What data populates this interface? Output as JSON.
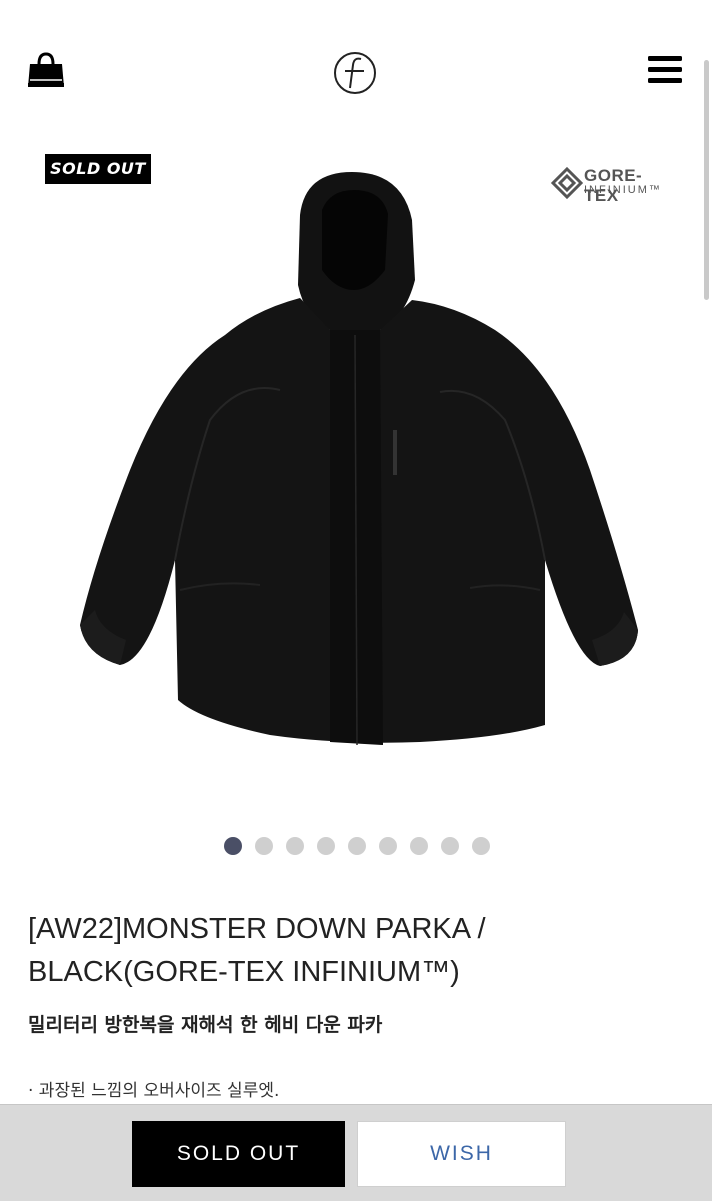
{
  "header": {
    "cart_icon": "shopping-bag-icon",
    "logo_icon": "brand-logo",
    "menu_icon": "hamburger-menu-icon"
  },
  "product": {
    "badge": "SOLD OUT",
    "partner_logo_top": "GORE-TEX",
    "partner_logo_bottom": "INFINIUM™",
    "image_count": 9,
    "active_image": 1,
    "title": "[AW22]MONSTER DOWN PARKA / BLACK(GORE-TEX INFINIUM™)",
    "subtitle": "밀리터리 방한복을 재해석 한 헤비 다운 파카",
    "bullet": "· 과장된 느낌의 오버사이즈 실루엣."
  },
  "actions": {
    "sold_out_label": "SOLD OUT",
    "wish_label": "WISH"
  },
  "colors": {
    "active_dot": "#4a4f66",
    "wish_text": "#3c67a8",
    "bar_bg": "#d9d9d9"
  }
}
